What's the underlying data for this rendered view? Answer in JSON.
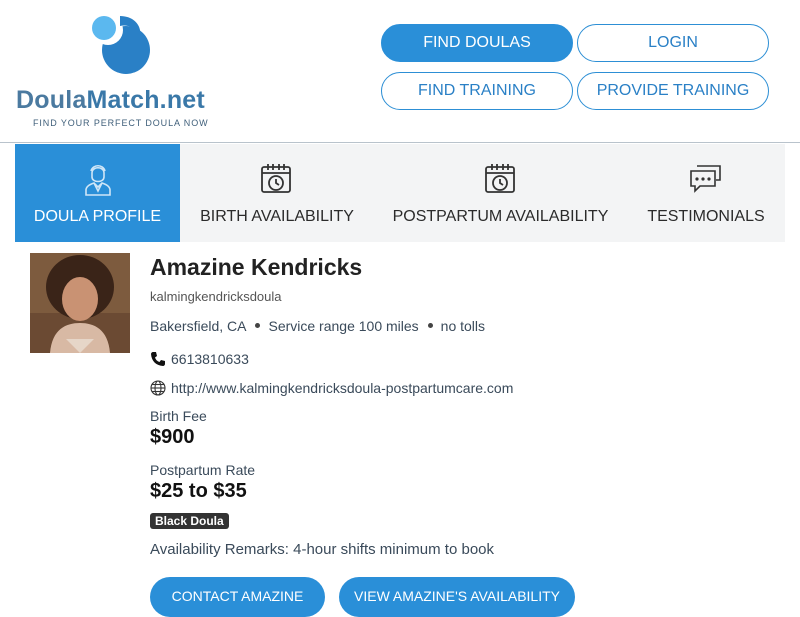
{
  "brand": {
    "name_part1": "Doula",
    "name_part2": "Match.net",
    "tagline": "FIND YOUR PERFECT DOULA NOW",
    "colors": {
      "primary": "#2a8fd8",
      "logo_dark": "#2a80c6",
      "logo_light": "#5bb8ef"
    }
  },
  "nav": {
    "find_doulas": "FIND DOULAS",
    "login": "LOGIN",
    "find_training": "FIND TRAINING",
    "provide_training": "PROVIDE TRAINING"
  },
  "tabs": [
    {
      "label": "DOULA PROFILE",
      "icon": "person-icon",
      "active": true
    },
    {
      "label": "BIRTH AVAILABILITY",
      "icon": "calendar-clock-icon",
      "active": false
    },
    {
      "label": "POSTPARTUM AVAILABILITY",
      "icon": "calendar-clock-icon",
      "active": false
    },
    {
      "label": "TESTIMONIALS",
      "icon": "chat-bubbles-icon",
      "active": false
    }
  ],
  "profile": {
    "name": "Amazine Kendricks",
    "handle": "kalmingkendricksdoula",
    "city": "Bakersfield, CA",
    "service_range": "Service range 100 miles",
    "tolls": "no tolls",
    "phone": "6613810633",
    "website": "http://www.kalmingkendricksdoula-postpartumcare.com",
    "birth_fee_label": "Birth Fee",
    "birth_fee": "$900",
    "postpartum_rate_label": "Postpartum Rate",
    "postpartum_rate": "$25 to $35",
    "badge": "Black Doula",
    "availability_remarks": "Availability Remarks: 4-hour shifts minimum to book"
  },
  "actions": {
    "contact": "CONTACT AMAZINE",
    "view_availability": "VIEW AMAZINE'S AVAILABILITY"
  }
}
